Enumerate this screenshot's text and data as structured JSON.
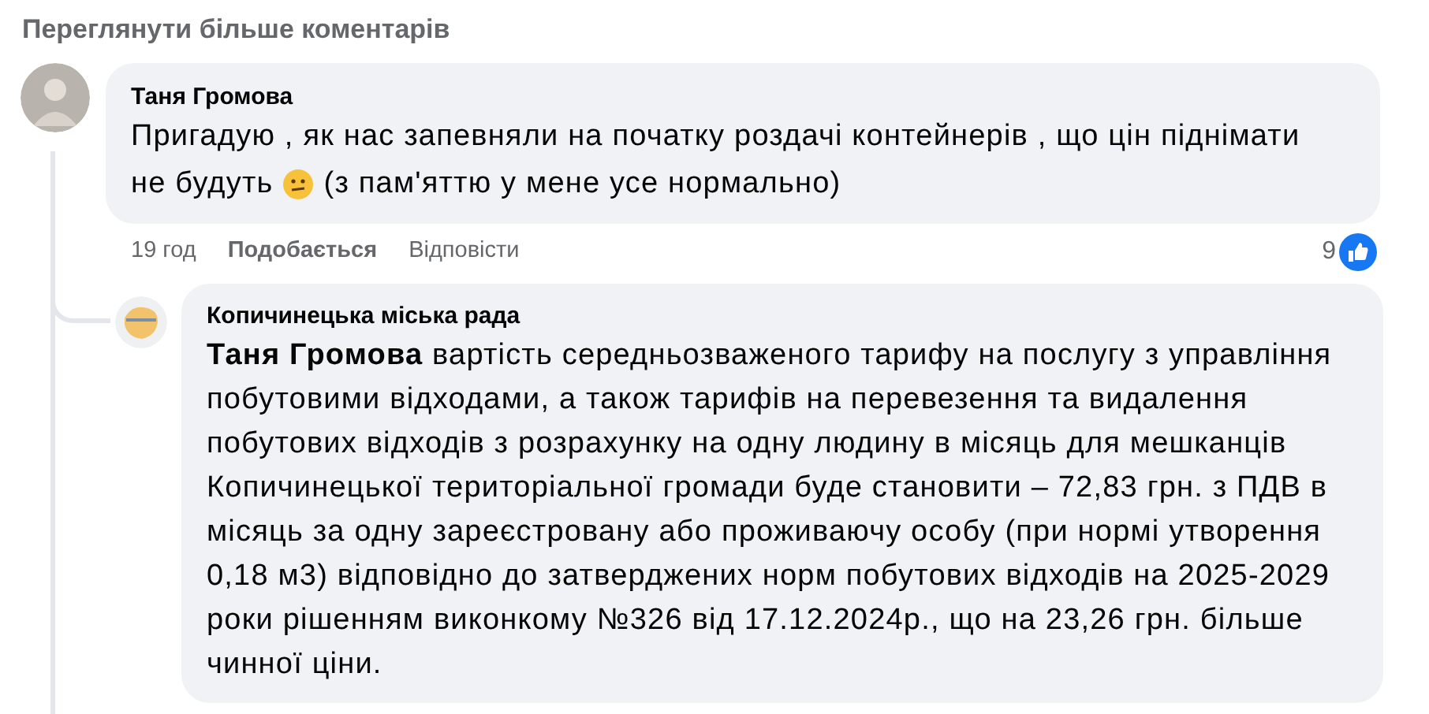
{
  "view_more": "Переглянути більше коментарів",
  "comment": {
    "author": "Таня Громова",
    "text_line_1": "Пригадую , як нас запевняли на початку роздачі контейнерів , що цін піднімати",
    "text_line_2": "не будуть",
    "text_after": "(з пам'яттю у мене усе нормально)",
    "time": "19 год",
    "like": "Подобається",
    "reply": "Відповісти",
    "reactions": "9"
  },
  "reply": {
    "author": "Копичинецька міська рада",
    "text": "**Таня Громова** вартість середньозваженого тарифу на послугу з управління побутовими відходами, а також тарифів на перевезення та видалення побутових відходів з розрахунку на одну людину в місяць для мешканців Копичинецької територіальної громади буде становити – 72,83 грн. з ПДВ в місяць за одну зареєстровану або проживаючу особу (при нормі утворення 0,18 м3) відповідно до затверджених норм побутових відходів на 2025-2029 роки рішенням виконкому №326 від 17.12.2024р., що на 23,26 грн. більше чинної ціни."
  }
}
